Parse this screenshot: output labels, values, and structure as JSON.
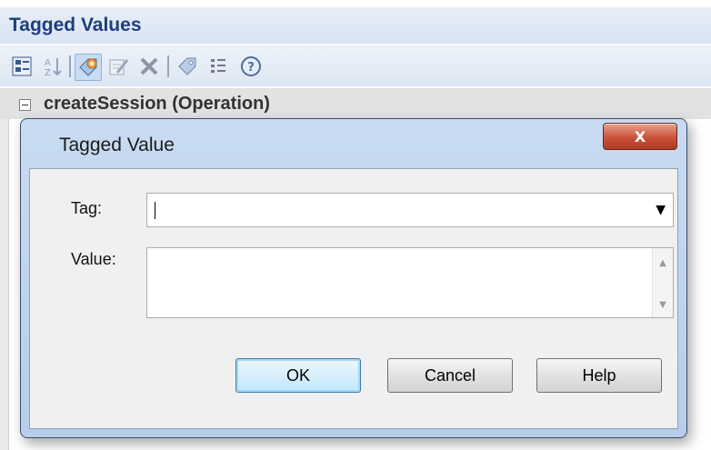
{
  "panel": {
    "title": "Tagged Values",
    "toolbar": {
      "icons": [
        "categorized-view-icon",
        "sort-az-icon",
        "new-tag-icon",
        "edit-tag-icon",
        "delete-icon",
        "tag-icon",
        "notes-icon",
        "help-icon"
      ]
    },
    "tree": {
      "node_label": "createSession (Operation)"
    }
  },
  "dialog": {
    "title": "Tagged Value",
    "close_label": "X",
    "tag_label": "Tag:",
    "tag_value": "",
    "value_label": "Value:",
    "value_text": "",
    "ok_label": "OK",
    "cancel_label": "Cancel",
    "help_label": "Help"
  },
  "colors": {
    "title_text": "#1e3f7a",
    "dialog_frame": "#b7cde9",
    "close_button": "#c9533a",
    "default_button_border": "#3c7fb1"
  }
}
